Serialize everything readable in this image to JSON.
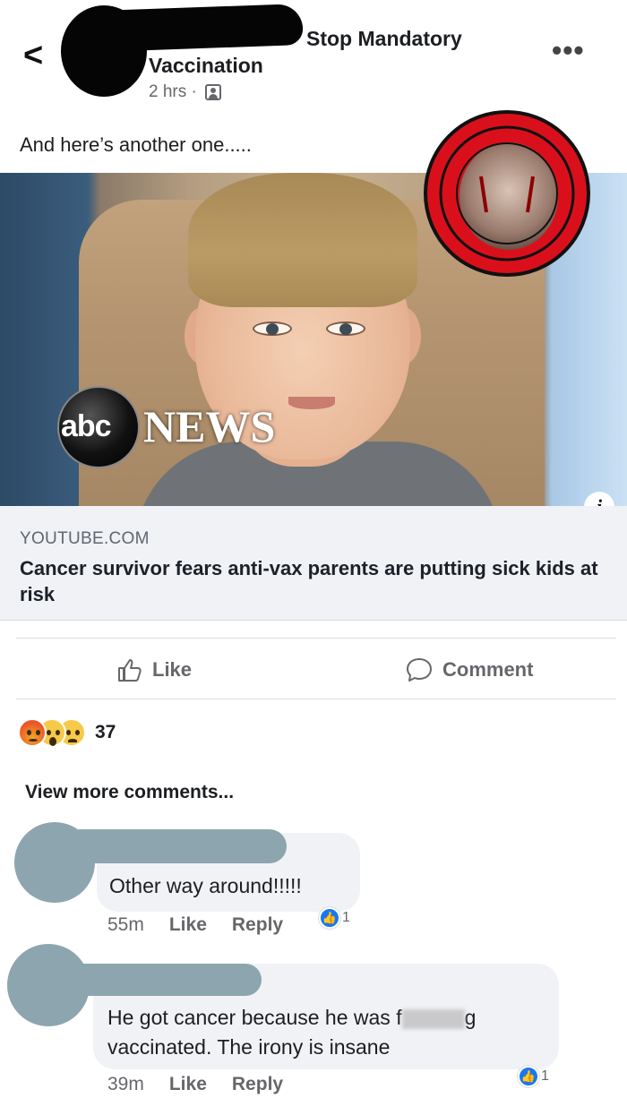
{
  "header": {
    "back_glyph": "<",
    "group_line1": "Stop Mandatory",
    "group_line2": "Vaccination",
    "time": "2 hrs ·",
    "more_glyph": "•••"
  },
  "post": {
    "text": "And here’s another one....."
  },
  "media": {
    "logo_abc": "abc",
    "logo_news": "NEWS",
    "info_glyph": "i"
  },
  "link": {
    "domain": "YOUTUBE.COM",
    "title": "Cancer survivor fears anti-vax parents are putting sick kids at risk"
  },
  "actions": {
    "like_label": "Like",
    "comment_label": "Comment"
  },
  "reactions": {
    "icons": [
      "angry-icon",
      "wow-icon",
      "sad-icon"
    ],
    "count": "37"
  },
  "comments": {
    "view_more": "View more comments...",
    "items": [
      {
        "text": "Other way around!!!!!",
        "time": "55m",
        "like": "Like",
        "reply": "Reply",
        "likes": "1"
      },
      {
        "text_before": "He got cancer because he was f",
        "text_after": "g",
        "text_line2": "vaccinated. The irony is insane",
        "time": "39m",
        "like": "Like",
        "reply": "Reply",
        "likes": "1"
      }
    ]
  },
  "colors": {
    "text": "#1c1e21",
    "secondary": "#65676b",
    "link_bg": "#f0f2f5",
    "fb_blue": "#1877f2",
    "redaction_dark": "#050505",
    "redaction_gray": "#8da5ae"
  }
}
